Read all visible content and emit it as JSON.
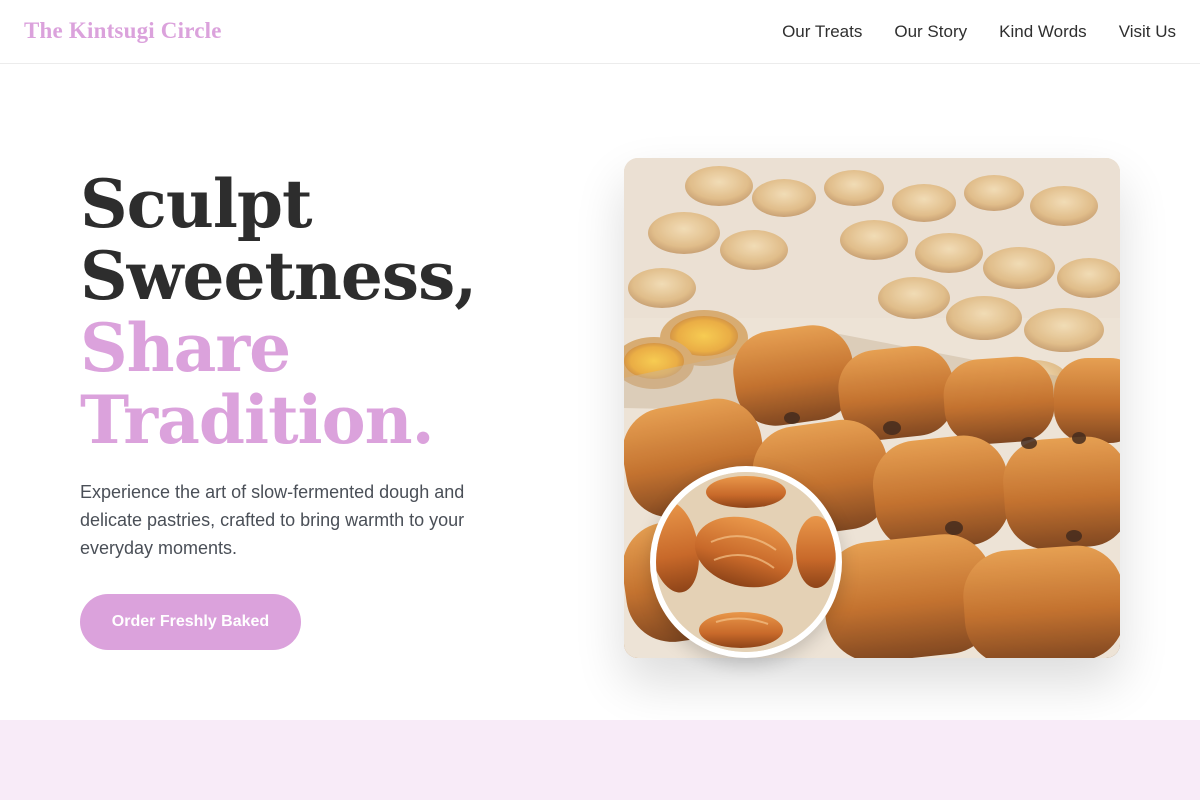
{
  "header": {
    "logo": "The Kintsugi Circle",
    "nav": [
      {
        "label": "Our Treats"
      },
      {
        "label": "Our Story"
      },
      {
        "label": "Kind Words"
      },
      {
        "label": "Visit Us"
      }
    ]
  },
  "hero": {
    "title_line1": "Sculpt",
    "title_line2": "Sweetness,",
    "title_line3": "Share",
    "title_line4": "Tradition.",
    "description": "Experience the art of slow-fermented dough and delicate pastries, crafted to bring warmth to your everyday moments.",
    "cta_label": "Order Freshly Baked"
  },
  "colors": {
    "accent": "#dba2dc",
    "heading": "#2d2d2d",
    "body_text": "#4a4f57",
    "band": "#f8ebf8"
  },
  "images": {
    "main": "pastry-display-photo",
    "inset": "croissants-photo"
  }
}
